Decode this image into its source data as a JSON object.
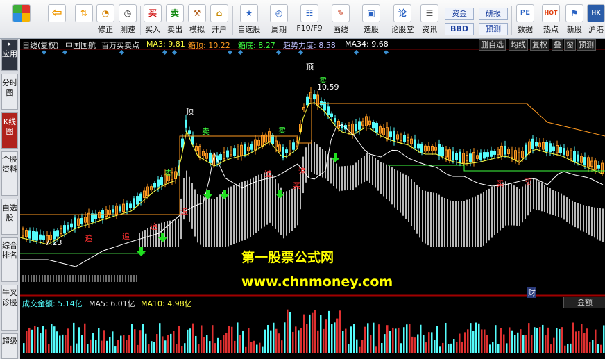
{
  "toolbar": {
    "items": [
      {
        "label": "",
        "icon": "app-grid-icon"
      },
      {
        "label": "",
        "icon": "back-arrow-icon"
      },
      {
        "label": "",
        "icon": "up-down-arrow-icon"
      },
      {
        "label": "修正",
        "icon": "recalc-clock-icon"
      },
      {
        "label": "测速",
        "icon": "speed-clock-icon"
      },
      {
        "label": "买入",
        "icon": "buy-icon",
        "glyph": "买"
      },
      {
        "label": "卖出",
        "icon": "sell-icon",
        "glyph": "卖"
      },
      {
        "label": "模拟",
        "icon": "hammer-icon"
      },
      {
        "label": "开户",
        "icon": "lock-icon"
      },
      {
        "label": "自选股",
        "icon": "star-window-icon"
      },
      {
        "label": "周期",
        "icon": "cycle-icon"
      },
      {
        "label": "F10/F9",
        "icon": "f10-icon"
      },
      {
        "label": "画线",
        "icon": "pencil-icon"
      },
      {
        "label": "选股",
        "icon": "select-stock-icon"
      },
      {
        "label": "论股堂",
        "icon": "forum-icon",
        "glyph": "论"
      },
      {
        "label": "资讯",
        "icon": "news-icon"
      },
      {
        "label": "数据",
        "icon": "pe-data-icon",
        "glyph": "PE"
      },
      {
        "label": "热点",
        "icon": "hot-icon",
        "glyph": "HOT"
      },
      {
        "label": "新股",
        "icon": "new-stock-icon"
      },
      {
        "label": "沪港",
        "icon": "sse-hk-icon"
      }
    ],
    "mini_buttons": {
      "fund": "资金",
      "bbd": "BBD",
      "research": "研报",
      "forecast": "预测"
    }
  },
  "sidebar": {
    "items": [
      {
        "label": "应用",
        "active": false
      },
      {
        "label": "分时图",
        "active": false
      },
      {
        "label": "K线图",
        "active": true
      },
      {
        "label": "个股资料",
        "active": false
      },
      {
        "label": "自选股",
        "active": false
      },
      {
        "label": "综合排名",
        "active": false
      },
      {
        "label": "牛叉诊股",
        "active": false
      },
      {
        "label": "超级",
        "active": false
      }
    ]
  },
  "chart_header": {
    "period": "日线(复权)",
    "stock": "中国国航",
    "indicator": "百万买卖点",
    "ma3": "MA3: 9.81",
    "top": "箱顶: 10.22",
    "bottom": "箱底: 8.27",
    "trend": "趋势力度: 8.58",
    "ma34": "MA34: 9.68",
    "right_buttons": [
      "删自选",
      "均线",
      "复权",
      "叠",
      "窗",
      "预测"
    ]
  },
  "volume_header": {
    "amount": "成交金额: 5.14亿",
    "ma5": "MA5: 6.01亿",
    "ma10": "MA10: 4.98亿",
    "unit_button": "金额"
  },
  "annotations": {
    "top_marker": "顶",
    "sell_marker": "卖",
    "buy_marker": "买",
    "chase_marker": "追",
    "peak_value": "10.59",
    "low_value": "7.23",
    "finance_marker": "财"
  },
  "watermark": {
    "line1": "第一股票公式网",
    "line2": "www.chnmoney.com"
  },
  "colors": {
    "up": "#ff5050",
    "down": "#54fcfc",
    "ma3": "#ffff40",
    "box_top": "#ff9a20",
    "box_bottom": "#40ff40",
    "trend": "#ffffff",
    "ma34": "#ffffff"
  }
}
